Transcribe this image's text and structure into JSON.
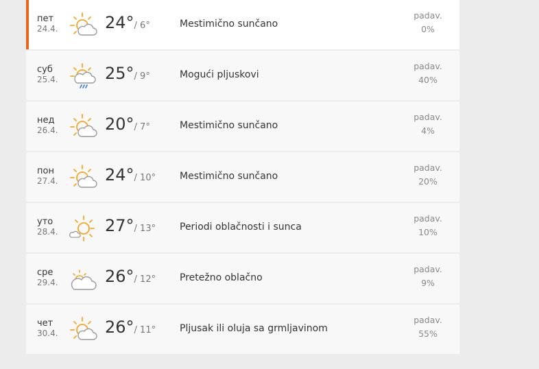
{
  "forecast": {
    "days": [
      {
        "day": "пет",
        "date": "24.4.",
        "hi": "24°",
        "lo": "/ 6°",
        "desc": "Mestimično sunčano",
        "precip_label": "padav.",
        "precip": "0%",
        "icon": "sun-cloud-icon"
      },
      {
        "day": "суб",
        "date": "25.4.",
        "hi": "25°",
        "lo": "/ 9°",
        "desc": "Mogući pljuskovi",
        "precip_label": "padav.",
        "precip": "40%",
        "icon": "sun-cloud-rain-icon"
      },
      {
        "day": "нед",
        "date": "26.4.",
        "hi": "20°",
        "lo": "/ 7°",
        "desc": "Mestimično sunčano",
        "precip_label": "padav.",
        "precip": "4%",
        "icon": "sun-cloud-icon"
      },
      {
        "day": "пон",
        "date": "27.4.",
        "hi": "24°",
        "lo": "/ 10°",
        "desc": "Mestimično sunčano",
        "precip_label": "padav.",
        "precip": "20%",
        "icon": "sun-cloud-icon"
      },
      {
        "day": "уто",
        "date": "28.4.",
        "hi": "27°",
        "lo": "/ 13°",
        "desc": "Periodi oblačnosti i sunca",
        "precip_label": "padav.",
        "precip": "10%",
        "icon": "sun-small-cloud-icon"
      },
      {
        "day": "сре",
        "date": "29.4.",
        "hi": "26°",
        "lo": "/ 12°",
        "desc": "Pretežno oblačno",
        "precip_label": "padav.",
        "precip": "9%",
        "icon": "cloud-sun-icon"
      },
      {
        "day": "чет",
        "date": "30.4.",
        "hi": "26°",
        "lo": "/ 11°",
        "desc": "Pljusak ili oluja sa grmljavinom",
        "precip_label": "padav.",
        "precip": "55%",
        "icon": "sun-cloud-storm-icon"
      }
    ]
  },
  "colors": {
    "accent": "#e8651e",
    "sun": "#f5a623",
    "cloud_stroke": "#9a9a9a",
    "rain": "#3a7bd5"
  }
}
